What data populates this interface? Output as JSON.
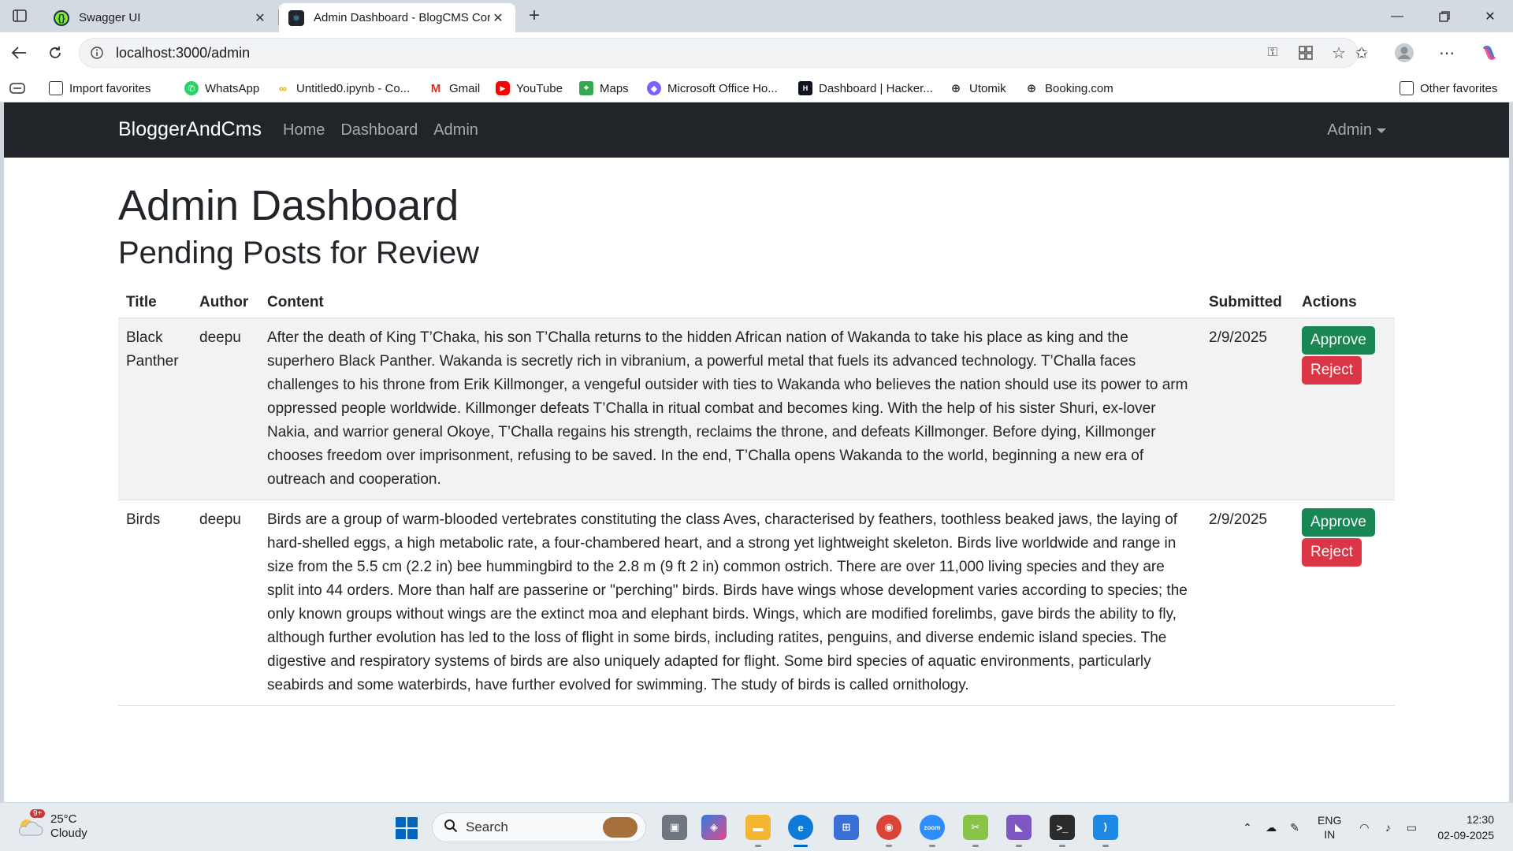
{
  "browser": {
    "tabs": [
      {
        "title": "Swagger UI",
        "active": false
      },
      {
        "title": "Admin Dashboard - BlogCMS Cor",
        "active": true
      }
    ],
    "url": "localhost:3000/admin",
    "favorites": [
      {
        "label": "Import favorites",
        "icon": "import-icon"
      },
      {
        "label": "WhatsApp",
        "icon": "whatsapp-icon"
      },
      {
        "label": "Untitled0.ipynb - Co...",
        "icon": "colab-icon"
      },
      {
        "label": "Gmail",
        "icon": "gmail-icon"
      },
      {
        "label": "YouTube",
        "icon": "youtube-icon"
      },
      {
        "label": "Maps",
        "icon": "maps-icon"
      },
      {
        "label": "Microsoft Office Ho...",
        "icon": "office-icon"
      },
      {
        "label": "Dashboard | Hacker...",
        "icon": "hackerrank-icon"
      },
      {
        "label": "Utomik",
        "icon": "globe-icon"
      },
      {
        "label": "Booking.com",
        "icon": "globe-icon"
      }
    ],
    "other_favorites": "Other favorites"
  },
  "app": {
    "brand": "BloggerAndCms",
    "nav": [
      "Home",
      "Dashboard",
      "Admin"
    ],
    "user_menu": "Admin",
    "page_title": "Admin Dashboard",
    "section_title": "Pending Posts for Review",
    "table": {
      "headers": [
        "Title",
        "Author",
        "Content",
        "Submitted",
        "Actions"
      ],
      "rows": [
        {
          "title": "Black Panther",
          "author": "deepu",
          "content": "After the death of King T’Chaka, his son T’Challa returns to the hidden African nation of Wakanda to take his place as king and the superhero Black Panther. Wakanda is secretly rich in vibranium, a powerful metal that fuels its advanced technology. T’Challa faces challenges to his throne from Erik Killmonger, a vengeful outsider with ties to Wakanda who believes the nation should use its power to arm oppressed people worldwide. Killmonger defeats T’Challa in ritual combat and becomes king. With the help of his sister Shuri, ex-lover Nakia, and warrior general Okoye, T’Challa regains his strength, reclaims the throne, and defeats Killmonger. Before dying, Killmonger chooses freedom over imprisonment, refusing to be saved. In the end, T’Challa opens Wakanda to the world, beginning a new era of outreach and cooperation.",
          "submitted": "2/9/2025",
          "approve": "Approve",
          "reject": "Reject"
        },
        {
          "title": "Birds",
          "author": "deepu",
          "content": "Birds are a group of warm-blooded vertebrates constituting the class Aves, characterised by feathers, toothless beaked jaws, the laying of hard-shelled eggs, a high metabolic rate, a four-chambered heart, and a strong yet lightweight skeleton. Birds live worldwide and range in size from the 5.5 cm (2.2 in) bee hummingbird to the 2.8 m (9 ft 2 in) common ostrich. There are over 11,000 living species and they are split into 44 orders. More than half are passerine or \"perching\" birds. Birds have wings whose development varies according to species; the only known groups without wings are the extinct moa and elephant birds. Wings, which are modified forelimbs, gave birds the ability to fly, although further evolution has led to the loss of flight in some birds, including ratites, penguins, and diverse endemic island species. The digestive and respiratory systems of birds are also uniquely adapted for flight. Some bird species of aquatic environments, particularly seabirds and some waterbirds, have further evolved for swimming. The study of birds is called ornithology.",
          "submitted": "2/9/2025",
          "approve": "Approve",
          "reject": "Reject"
        }
      ]
    }
  },
  "taskbar": {
    "weather_temp": "25°C",
    "weather_desc": "Cloudy",
    "weather_badge": "9+",
    "search_placeholder": "Search",
    "lang_top": "ENG",
    "lang_bottom": "IN",
    "time": "12:30",
    "date": "02-09-2025"
  },
  "colors": {
    "navbar": "#212529",
    "approve": "#198754",
    "reject": "#dc3545",
    "stripe": "#f2f2f2"
  }
}
